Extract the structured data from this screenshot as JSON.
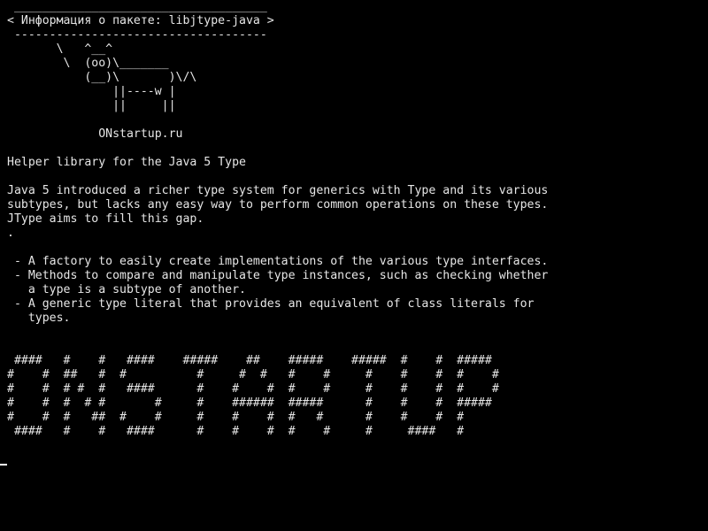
{
  "terminal": {
    "lines": [
      " ____________________________________",
      "< Информация о пакете: libjtype-java >",
      " ------------------------------------",
      "       \\   ^__^",
      "        \\  (oo)\\_______",
      "           (__)\\       )\\/\\",
      "               ||----w |",
      "               ||     ||",
      "",
      "             ONstartup.ru",
      "",
      "Helper library for the Java 5 Type",
      "",
      "Java 5 introduced a richer type system for generics with Type and its various",
      "subtypes, but lacks any easy way to perform common operations on these types.",
      "JType aims to fill this gap.",
      ".",
      "",
      " - A factory to easily create implementations of the various type interfaces.",
      " - Methods to compare and manipulate type instances, such as checking whether",
      "   a type is a subtype of another.",
      " - A generic type literal that provides an equivalent of class literals for",
      "   types.",
      "",
      "",
      " ####   #    #   ####    #####    ##    #####    #####  #    #  #####",
      "#    #  ##   #  #          #     #  #   #    #     #    #    #  #    #",
      "#    #  # #  #   ####      #    #    #  #    #     #    #    #  #    #",
      "#    #  #  # #       #     #    ######  #####      #    #    #  #####",
      "#    #  #   ##  #    #     #    #    #  #   #      #    #    #  #",
      " ####   #    #   ####      #    #    #  #    #     #     ####   #"
    ]
  }
}
